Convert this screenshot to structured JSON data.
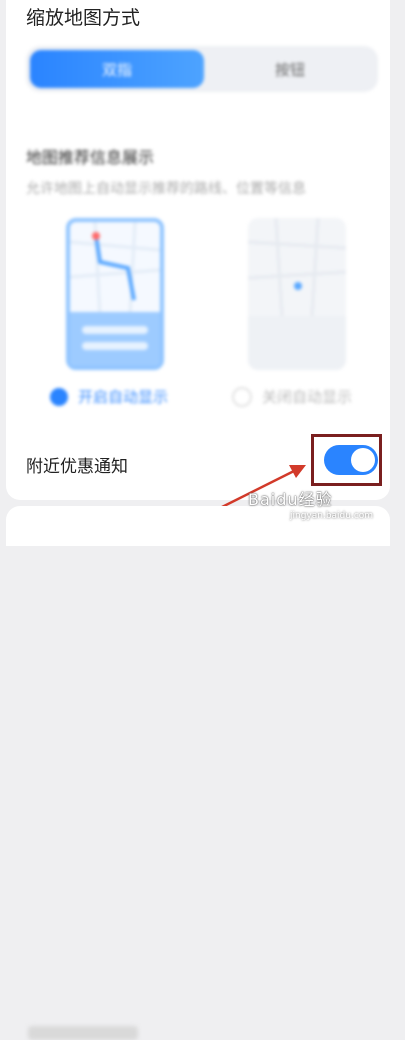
{
  "zoom_section": {
    "title": "缩放地图方式",
    "options": [
      "双指",
      "按钮"
    ]
  },
  "recommend_section": {
    "title": "地图推荐信息展示",
    "description": "允许地图上自动显示推荐的路线、位置等信息",
    "options": [
      {
        "label": "开启自动显示",
        "selected": true
      },
      {
        "label": "关闭自动显示",
        "selected": false
      }
    ]
  },
  "notify_section": {
    "label": "附近优惠通知",
    "toggle_on": true
  },
  "watermark": {
    "text": "Baidu经验",
    "sub": "jingyan.baidu.com"
  },
  "colors": {
    "accent": "#2a84ff",
    "highlight_box": "#7a1f1f",
    "arrow": "#d23a2a"
  }
}
